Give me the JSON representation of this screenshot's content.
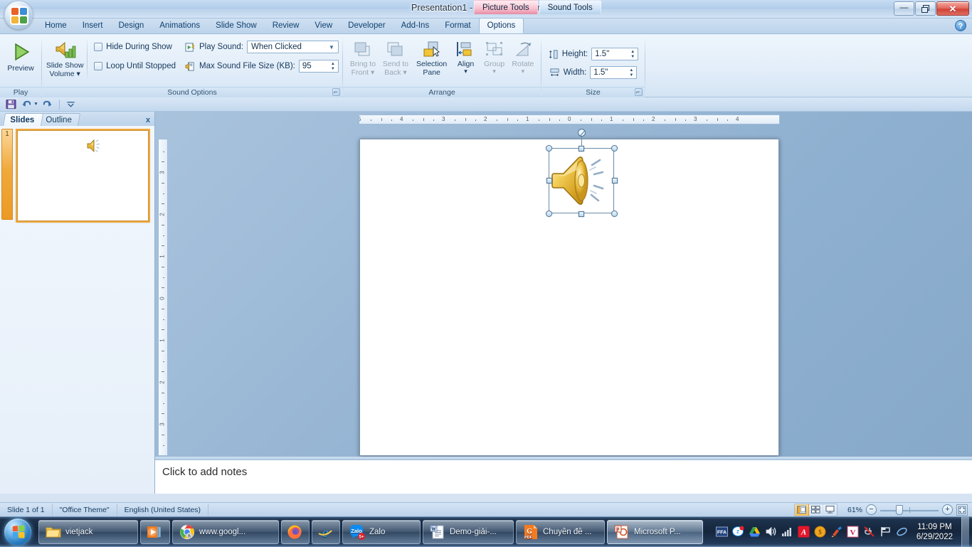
{
  "window": {
    "title": "Presentation1 - Microsoft PowerPoint",
    "minimize_label": "—",
    "restore_label": "❐",
    "close_label": "✕",
    "help_label": "?"
  },
  "contextual_tabs": [
    {
      "label": "Picture Tools",
      "color": "#e88aa4"
    },
    {
      "label": "Sound Tools",
      "color": "#b6d2ec"
    }
  ],
  "ribbon_tabs": [
    {
      "label": "Home",
      "active": false
    },
    {
      "label": "Insert",
      "active": false
    },
    {
      "label": "Design",
      "active": false
    },
    {
      "label": "Animations",
      "active": false
    },
    {
      "label": "Slide Show",
      "active": false
    },
    {
      "label": "Review",
      "active": false
    },
    {
      "label": "View",
      "active": false
    },
    {
      "label": "Developer",
      "active": false
    },
    {
      "label": "Add-Ins",
      "active": false
    },
    {
      "label": "Format",
      "active": false
    },
    {
      "label": "Options",
      "active": true
    }
  ],
  "ribbon": {
    "play_group": {
      "label": "Play",
      "preview_button": "Preview"
    },
    "sound_options_group": {
      "label": "Sound Options",
      "slide_show_volume": "Slide Show\nVolume",
      "slide_show_volume_line1": "Slide Show",
      "slide_show_volume_line2": "Volume",
      "hide_during_show": "Hide During Show",
      "hide_during_show_checked": false,
      "loop_until_stopped": "Loop Until Stopped",
      "loop_until_stopped_checked": false,
      "play_sound_label": "Play Sound:",
      "play_sound_value": "When Clicked",
      "max_file_size_label": "Max Sound File Size (KB):",
      "max_file_size_value": "95"
    },
    "arrange_group": {
      "label": "Arrange",
      "bring_to_front_line1": "Bring to",
      "bring_to_front_line2": "Front",
      "send_to_back_line1": "Send to",
      "send_to_back_line2": "Back",
      "selection_pane_line1": "Selection",
      "selection_pane_line2": "Pane",
      "align": "Align",
      "group": "Group",
      "rotate": "Rotate"
    },
    "size_group": {
      "label": "Size",
      "height_label": "Height:",
      "height_value": "1.5\"",
      "width_label": "Width:",
      "width_value": "1.5\""
    }
  },
  "quick_access": {
    "save": "save-icon",
    "undo": "undo-icon",
    "redo": "redo-icon",
    "customize": "customize-icon"
  },
  "left_pane": {
    "tab_slides": "Slides",
    "tab_outline": "Outline",
    "close": "x",
    "slide_number": "1"
  },
  "rulers": {
    "horizontal": [
      "5",
      "4",
      "3",
      "2",
      "1",
      "0",
      "1",
      "2",
      "3",
      "4"
    ],
    "vertical": [
      "3",
      "2",
      "1",
      "0",
      "1",
      "2",
      "3"
    ]
  },
  "notes": {
    "placeholder": "Click to add notes"
  },
  "status_bar": {
    "slide_count": "Slide 1 of 1",
    "theme": "\"Office Theme\"",
    "language": "English (United States)",
    "zoom": "61%",
    "zoom_out": "−",
    "zoom_in": "+",
    "view_normal": "normal-view-icon",
    "view_sorter": "slide-sorter-icon",
    "view_show": "slide-show-icon",
    "fit_window": "fit-to-window-icon"
  },
  "taskbar": {
    "start": "windows-start-orb",
    "items": [
      {
        "label": "vietjack",
        "icon": "folder-icon"
      },
      {
        "label": "",
        "icon": "media-player-icon"
      },
      {
        "label": "www.googl...",
        "icon": "chrome-icon"
      },
      {
        "label": "",
        "icon": "firefox-icon"
      },
      {
        "label": "",
        "icon": "internet-explorer-icon"
      },
      {
        "label": "Zalo",
        "icon": "zalo-icon",
        "badge": "5+"
      },
      {
        "label": "Demo-giải-...",
        "icon": "word-icon"
      },
      {
        "label": "Chuyên đề ...",
        "icon": "pdf-icon"
      },
      {
        "label": "Microsoft P...",
        "icon": "powerpoint-icon"
      }
    ],
    "tray": [
      "ffa-icon",
      "zalo-tray-icon",
      "google-drive-icon",
      "volume-icon",
      "network-icon",
      "avira-icon",
      "coin-icon",
      "cleaner-icon",
      "v-icon",
      "unplug-icon",
      "flag-icon",
      "loop-icon"
    ],
    "clock_time": "11:09 PM",
    "clock_date": "6/29/2022"
  }
}
